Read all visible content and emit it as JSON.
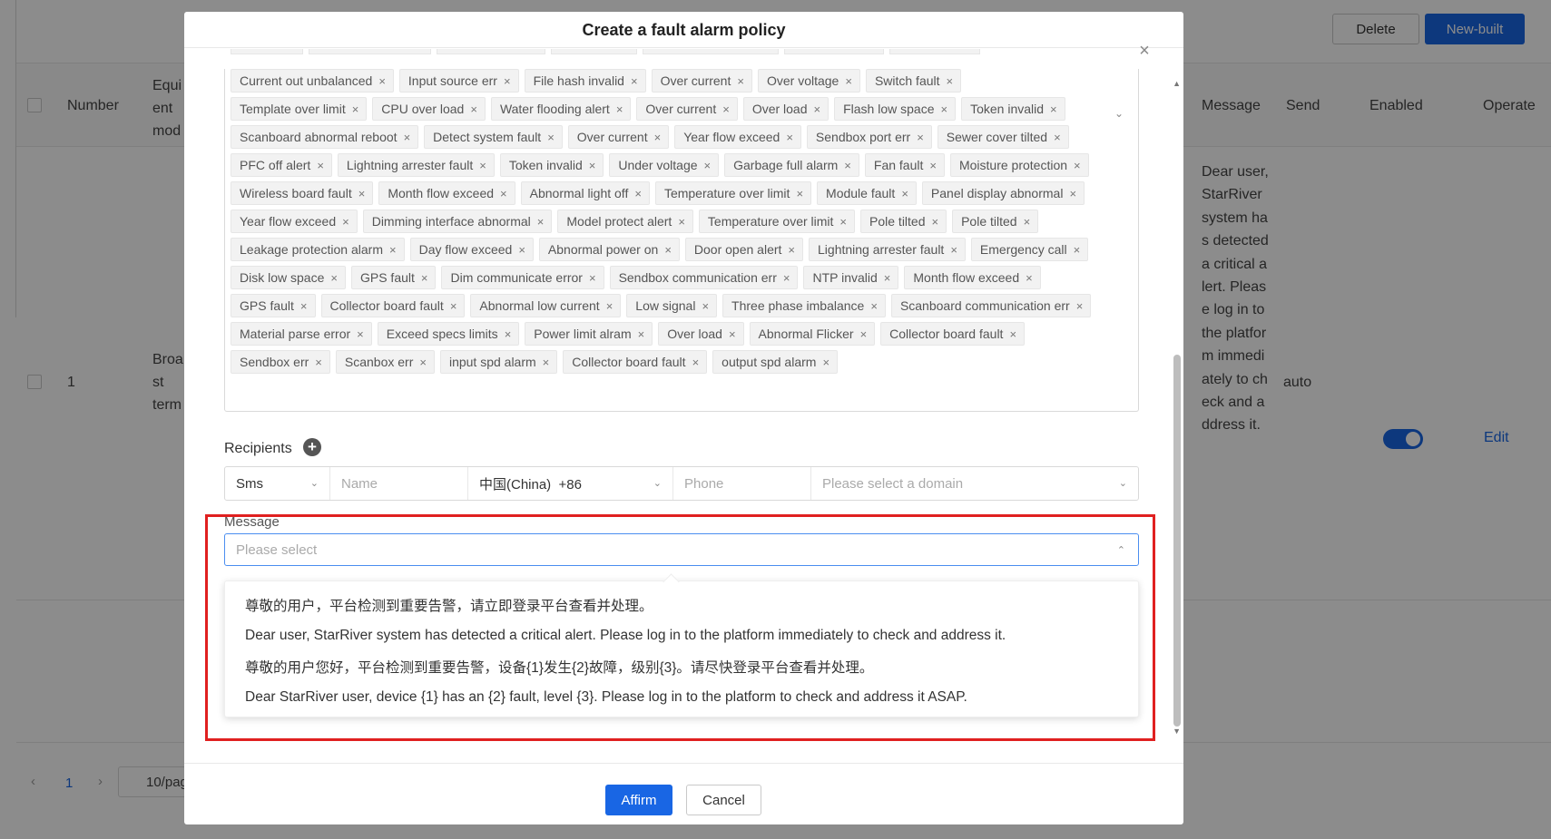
{
  "background": {
    "toolbar": {
      "delete_label": "Delete",
      "newbuilt_label": "New-built"
    },
    "table": {
      "headers": {
        "number": "Number",
        "equipment_model": "Equi\nent\nmod",
        "message": "Message",
        "send": "Send",
        "enabled": "Enabled",
        "operate": "Operate"
      },
      "row": {
        "number": "1",
        "equipment_model": "Broa\nst\nterm",
        "message": "Dear user, StarRiver system has detected a critical alert. Please log in to the platform immediately to check and address it.",
        "send": "auto",
        "enabled": true,
        "operate": "Edit"
      }
    },
    "pagination": {
      "prev": "‹",
      "current_page": "1",
      "next": "›",
      "page_size": "10/pag"
    }
  },
  "modal": {
    "title": "Create a fault alarm policy",
    "close_icon": "close-icon",
    "fault_tags": [
      "Current out unbalanced",
      "Input source err",
      "File hash invalid",
      "Over current",
      "Over voltage",
      "Switch fault",
      "Template over limit",
      "CPU over load",
      "Water flooding alert",
      "Over current",
      "Over load",
      "Flash low space",
      "Token invalid",
      "Scanboard abnormal reboot",
      "Detect system fault",
      "Over current",
      "Year flow exceed",
      "Sendbox port err",
      "Sewer cover tilted",
      "PFC off alert",
      "Lightning arrester fault",
      "Token invalid",
      "Under voltage",
      "Garbage full alarm",
      "Fan fault",
      "Moisture protection",
      "Wireless board fault",
      "Month flow exceed",
      "Abnormal light off",
      "Temperature over limit",
      "Module fault",
      "Panel display abnormal",
      "Year flow exceed",
      "Dimming interface abnormal",
      "Model protect alert",
      "Temperature over limit",
      "Pole tilted",
      "Pole tilted",
      "Leakage protection alarm",
      "Day flow exceed",
      "Abnormal power on",
      "Door open alert",
      "Lightning arrester fault",
      "Emergency call",
      "Disk low space",
      "GPS fault",
      "Dim communicate error",
      "Sendbox communication err",
      "NTP invalid",
      "Month flow exceed",
      "GPS fault",
      "Collector board fault",
      "Abnormal low current",
      "Low signal",
      "Three phase imbalance",
      "Scanboard communication err",
      "Material parse error",
      "Exceed specs limits",
      "Power limit alram",
      "Over load",
      "Abnormal Flicker",
      "Collector board fault",
      "Sendbox err",
      "Scanbox err",
      "input spd alarm",
      "Collector board fault",
      "output spd alarm"
    ],
    "recipients": {
      "label": "Recipients",
      "type_value": "Sms",
      "name_placeholder": "Name",
      "country_code": "中国(China)  +86",
      "phone_placeholder": "Phone",
      "domain_placeholder": "Please select a domain"
    },
    "message": {
      "label": "Message",
      "placeholder": "Please select",
      "options": [
        "尊敬的用户，平台检测到重要告警，请立即登录平台查看并处理。",
        "Dear user, StarRiver system has detected a critical alert. Please log in to the platform immediately to check and address it.",
        "尊敬的用户您好，平台检测到重要告警，设备{1}发生{2}故障，级别{3}。请尽快登录平台查看并处理。",
        "Dear StarRiver user, device {1} has an {2} fault, level {3}. Please log in to the platform to check and address it ASAP."
      ]
    },
    "footer": {
      "affirm_label": "Affirm",
      "cancel_label": "Cancel"
    }
  },
  "colors": {
    "primary": "#1966e4",
    "highlight": "#e02020",
    "overlay": "rgba(0,0,0,0.45)"
  }
}
